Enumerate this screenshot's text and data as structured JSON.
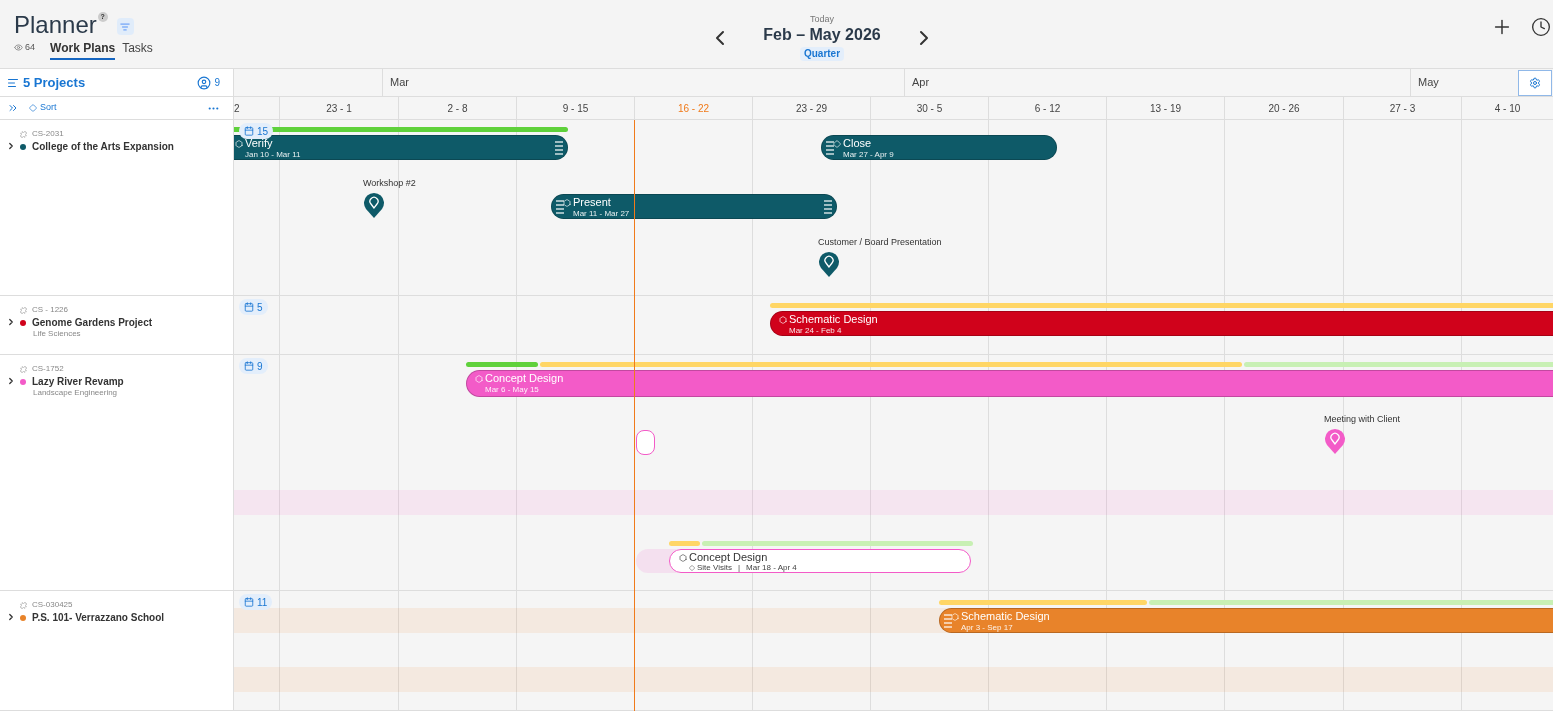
{
  "header": {
    "title": "Planner",
    "help": "?",
    "views": "64",
    "tabs": [
      {
        "label": "Work Plans",
        "selected": true
      },
      {
        "label": "Tasks",
        "selected": false
      }
    ],
    "today": "Today",
    "range": "Feb – May 2026",
    "scale": "Quarter"
  },
  "sidebar": {
    "projects": "5 Projects",
    "people": "9",
    "sort": "Sort"
  },
  "timeline": {
    "months": [
      "Mar",
      "Apr",
      "May"
    ],
    "weeks": [
      {
        "label": "2",
        "current": false
      },
      {
        "label": "23 - 1",
        "current": false
      },
      {
        "label": "2 - 8",
        "current": false
      },
      {
        "label": "9 - 15",
        "current": false
      },
      {
        "label": "16 - 22",
        "current": true
      },
      {
        "label": "23 - 29",
        "current": false
      },
      {
        "label": "30 - 5",
        "current": false
      },
      {
        "label": "6 - 12",
        "current": false
      },
      {
        "label": "13 - 19",
        "current": false
      },
      {
        "label": "20 - 26",
        "current": false
      },
      {
        "label": "27 - 3",
        "current": false
      },
      {
        "label": "4 - 10",
        "current": false
      }
    ]
  },
  "projects": [
    {
      "code": "CS-2031",
      "name": "College of the Arts Expansion",
      "color": "#0e5a68",
      "expanded": false,
      "count": "15",
      "items": [
        {
          "kind": "phase",
          "title": "Verify",
          "dates": "Jan 10 - Mar 11",
          "progress": [
            {
              "color": "#5fd13b"
            }
          ]
        },
        {
          "kind": "event",
          "title": "Workshop #2"
        },
        {
          "kind": "phase",
          "title": "Present",
          "dates": "Mar 11 - Mar 27"
        },
        {
          "kind": "gate",
          "title": "Close",
          "dates": "Mar 27 - Apr 9"
        },
        {
          "kind": "event",
          "title": "Customer / Board Presentation"
        }
      ]
    },
    {
      "code": "CS - 1226",
      "name": "Genome Gardens Project",
      "subtitle": "Life Sciences",
      "color": "#d0021b",
      "expanded": false,
      "count": "5",
      "items": [
        {
          "kind": "phase",
          "title": "Schematic Design",
          "dates": "Mar 24 - Feb 4",
          "progress": [
            {
              "color": "#ffd666"
            }
          ]
        }
      ]
    },
    {
      "code": "CS-1752",
      "name": "Lazy River Revamp",
      "subtitle": "Landscape Engineering",
      "color": "#f35bc8",
      "expanded": false,
      "count": "9",
      "items": [
        {
          "kind": "phase",
          "title": "Concept Design",
          "dates": "Mar 6 - May 15",
          "progress": [
            {
              "color": "#5fd13b"
            },
            {
              "color": "#ffd666"
            },
            {
              "color": "#c8f0b4"
            }
          ]
        },
        {
          "kind": "slot"
        },
        {
          "kind": "event",
          "title": "Meeting with Client"
        },
        {
          "kind": "subphase",
          "title": "Concept Design",
          "detail": "Site Visits",
          "separator": "|",
          "dates": "Mar 18 - Apr 4",
          "progress": [
            {
              "color": "#ffd666"
            },
            {
              "color": "#c8f0b4"
            }
          ]
        }
      ]
    },
    {
      "code": "CS-030425",
      "name": "P.S. 101- Verrazzano School",
      "color": "#e8832a",
      "expanded": false,
      "count": "11",
      "items": [
        {
          "kind": "phase",
          "title": "Schematic Design",
          "dates": "Apr 3 - Sep 17",
          "progress": [
            {
              "color": "#ffd666"
            },
            {
              "color": "#c8f0b4"
            }
          ]
        }
      ]
    }
  ]
}
